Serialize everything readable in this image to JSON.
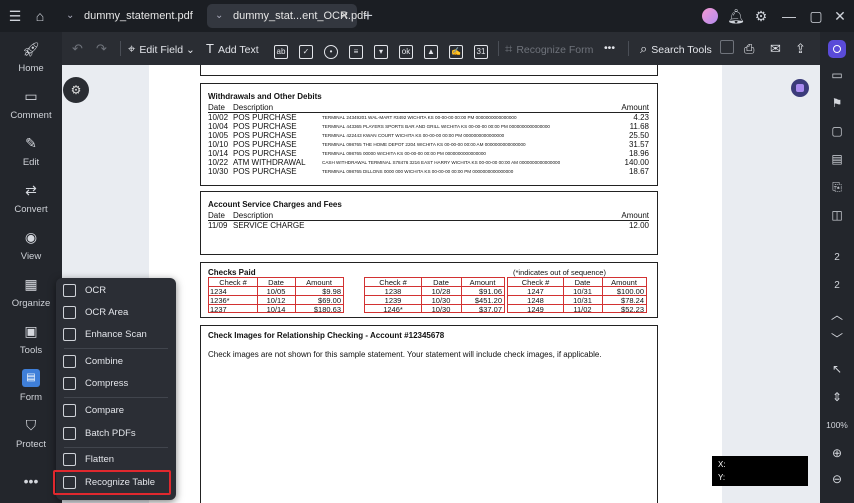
{
  "titlebar": {
    "tab1": "dummy_statement.pdf",
    "tab2": "dummy_stat...ent_OCR.pdf",
    "new_tab": "+"
  },
  "leftnav": [
    {
      "label": "Home"
    },
    {
      "label": "Comment"
    },
    {
      "label": "Edit"
    },
    {
      "label": "Convert"
    },
    {
      "label": "View"
    },
    {
      "label": "Organize"
    },
    {
      "label": "Tools"
    },
    {
      "label": "Form"
    },
    {
      "label": "Protect"
    }
  ],
  "toolbar": {
    "edit_field": "Edit Field",
    "add_text": "Add Text",
    "recognize_form": "Recognize Form",
    "search_tools": "Search Tools"
  },
  "rightpanel": {
    "page_current": "2",
    "page_total": "2",
    "zoom": "100%"
  },
  "menu": [
    {
      "label": "OCR"
    },
    {
      "label": "OCR Area"
    },
    {
      "label": "Enhance Scan"
    },
    {
      "label": "Combine"
    },
    {
      "label": "Compress"
    },
    {
      "label": "Compare"
    },
    {
      "label": "Batch PDFs"
    },
    {
      "label": "Flatten"
    },
    {
      "label": "Recognize Table"
    }
  ],
  "coords": {
    "x": "X:",
    "y": "Y:"
  },
  "doc": {
    "withdrawals": {
      "title": "Withdrawals and Other Debits",
      "hdr_date": "Date",
      "hdr_desc": "Description",
      "hdr_amt": "Amount",
      "rows": [
        {
          "date": "10/02",
          "type": "POS PURCHASE",
          "detail": "TERMINAL 24349201 WAL-MART #3492 WICHITA KS 00-00-00 00:00 PM 0000000000000000",
          "amt": "4.23"
        },
        {
          "date": "10/04",
          "type": "POS PURCHASE",
          "detail": "TERMINAL 443365 PLAYERS SPORTS BAR AND GRILL WICHITA KS 00-00-00 00:00 PM 0000000000000000",
          "amt": "11.68"
        },
        {
          "date": "10/05",
          "type": "POS PURCHASE",
          "detail": "TERMINAL 422443 KWAN COURT WICHITA KS 00-00-00 00:00 PM 0000000000000000",
          "amt": "25.50"
        },
        {
          "date": "10/10",
          "type": "POS PURCHASE",
          "detail": "TERMINAL 098765 THE HOME DEPOT 2204 WICHITA KS 00-00-00 00:00 AM 0000000000000000",
          "amt": "31.57"
        },
        {
          "date": "10/14",
          "type": "POS PURCHASE",
          "detail": "TERMINAL 098765 00000 WICHITA KS 00-00-00 00:00 PM 0000000000000000",
          "amt": "18.96"
        },
        {
          "date": "10/22",
          "type": "ATM WITHDRAWAL",
          "detail": "CASH WITHDRAWAL TERMINAL S78476 3216 EAST HARRY WICHITA KS 00-00-00 00:00 AM 0000000000000000",
          "amt": "140.00"
        },
        {
          "date": "10/30",
          "type": "POS PURCHASE",
          "detail": "TERMINAL 098765 DILLONS 0000 000 WICHITA KS 00-00-00 00:00 PM 0000000000000000",
          "amt": "18.67"
        }
      ]
    },
    "service": {
      "title": "Account Service Charges and Fees",
      "hdr_date": "Date",
      "hdr_desc": "Description",
      "hdr_amt": "Amount",
      "rows": [
        {
          "date": "11/09",
          "desc": "SERVICE CHARGE",
          "amt": "12.00"
        }
      ]
    },
    "checks": {
      "title": "Checks Paid",
      "note": "(*indicates out of sequence)",
      "headers": [
        "Check #",
        "Date",
        "Amount"
      ],
      "groups": [
        [
          [
            "1234",
            "10/05",
            "$9.98"
          ],
          [
            "1236*",
            "10/12",
            "$69.00"
          ],
          [
            "1237",
            "10/14",
            "$180.63"
          ]
        ],
        [
          [
            "1238",
            "10/28",
            "$91.06"
          ],
          [
            "1239",
            "10/30",
            "$451.20"
          ],
          [
            "1246*",
            "10/30",
            "$37.07"
          ]
        ],
        [
          [
            "1247",
            "10/31",
            "$100.00"
          ],
          [
            "1248",
            "10/31",
            "$78.24"
          ],
          [
            "1249",
            "11/02",
            "$52.23"
          ]
        ]
      ]
    },
    "images": {
      "title": "Check Images for Relationship Checking - Account #12345678",
      "text": "Check images are not shown for this sample statement.  Your statement will include check images, if applicable."
    }
  }
}
